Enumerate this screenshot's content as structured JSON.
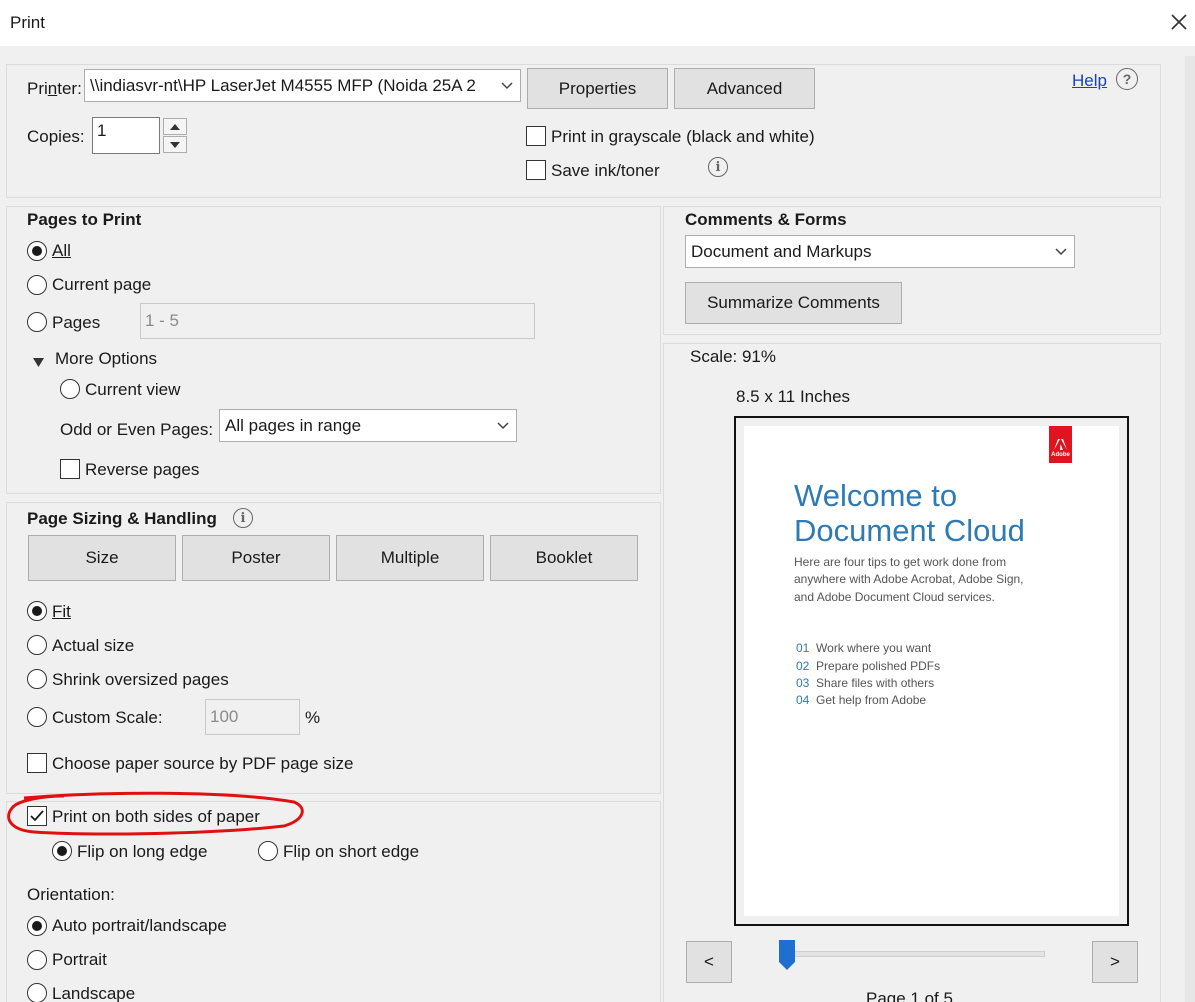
{
  "window": {
    "title": "Print"
  },
  "printer": {
    "label": "Printer:",
    "value": "\\\\indiasvr-nt\\HP LaserJet M4555 MFP (Noida 25A 2",
    "properties": "Properties",
    "advanced": "Advanced",
    "help": "Help",
    "copies_label": "Copies:",
    "copies_value": "1",
    "grayscale": "Print in grayscale (black and white)",
    "save_ink": "Save ink/toner"
  },
  "pages_to_print": {
    "heading": "Pages to Print",
    "all": "All",
    "current_page": "Current page",
    "pages": "Pages",
    "pages_value": "1 - 5",
    "more_options": "More Options",
    "current_view": "Current view",
    "odd_even_label": "Odd or Even Pages:",
    "odd_even_value": "All pages in range",
    "reverse": "Reverse pages"
  },
  "sizing": {
    "heading": "Page Sizing & Handling",
    "tabs": [
      "Size",
      "Poster",
      "Multiple",
      "Booklet"
    ],
    "fit": "Fit",
    "actual": "Actual size",
    "shrink": "Shrink oversized pages",
    "custom": "Custom Scale:",
    "custom_value": "100",
    "percent": "%",
    "paper_source": "Choose paper source by PDF page size"
  },
  "duplex": {
    "both_sides": "Print on both sides of paper",
    "long_edge": "Flip on long edge",
    "short_edge": "Flip on short edge"
  },
  "orientation": {
    "label": "Orientation:",
    "auto": "Auto portrait/landscape",
    "portrait": "Portrait",
    "landscape": "Landscape"
  },
  "comments": {
    "heading": "Comments & Forms",
    "value": "Document and Markups",
    "summarize": "Summarize Comments"
  },
  "preview": {
    "scale": "Scale:  91%",
    "size": "8.5 x 11 Inches",
    "prev": "<",
    "next": ">",
    "page_of": "Page 1 of 5",
    "slider_fraction": 0.0,
    "doc": {
      "logo": "Adobe",
      "title_line1": "Welcome to",
      "title_line2": "Document Cloud",
      "intro": [
        "Here are four tips to get work done from",
        "anywhere with Adobe Acrobat, Adobe Sign,",
        "and Adobe Document Cloud services."
      ],
      "tips": [
        {
          "num": "01",
          "text": "Work where you want"
        },
        {
          "num": "02",
          "text": "Prepare polished PDFs"
        },
        {
          "num": "03",
          "text": "Share files with others"
        },
        {
          "num": "04",
          "text": "Get help from Adobe"
        }
      ]
    }
  },
  "colors": {
    "accent": "#2d7ab5",
    "adobe_red": "#e0141e",
    "highlight_ring": "#e01010",
    "slider": "#1f6fd1"
  }
}
